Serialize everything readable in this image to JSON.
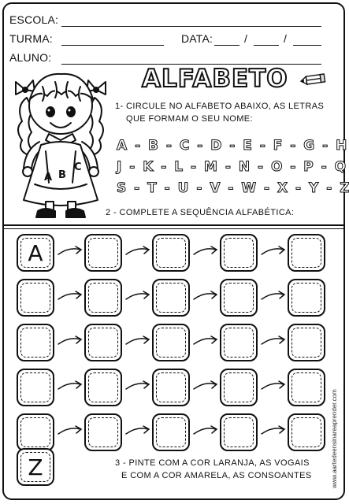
{
  "header": {
    "school_label": "ESCOLA:",
    "class_label": "TURMA:",
    "date_label": "DATA:",
    "date_sep1": "/",
    "date_sep2": "/",
    "student_label": "ALUNO:"
  },
  "title": "ALFABETO",
  "instructions": {
    "q1_line1": "1- CIRCULE NO ALFABETO ABAIXO, AS LETRAS",
    "q1_line2": "QUE FORMAM O SEU NOME:",
    "q2": "2 - COMPLETE A SEQUÊNCIA ALFABÉTICA:",
    "q3_line1": "3 - PINTE COM A COR LARANJA, AS VOGAIS",
    "q3_line2": "E COM A COR AMARELA, AS CONSOANTES"
  },
  "alphabet_rows": [
    "A - B - C - D - E - F - G - H - I",
    "J - K - L - M - N - O - P - Q - R",
    "S - T - U - V - W - X - Y - Z"
  ],
  "illustration": {
    "dress_letters": [
      "A",
      "B",
      "C"
    ]
  },
  "grid": {
    "first_letter": "A",
    "last_letter": "Z"
  },
  "website": "www.aartedeensinareaprender.com",
  "icons": [
    "pencil-icon",
    "arrow-icon",
    "girl-illustration"
  ]
}
